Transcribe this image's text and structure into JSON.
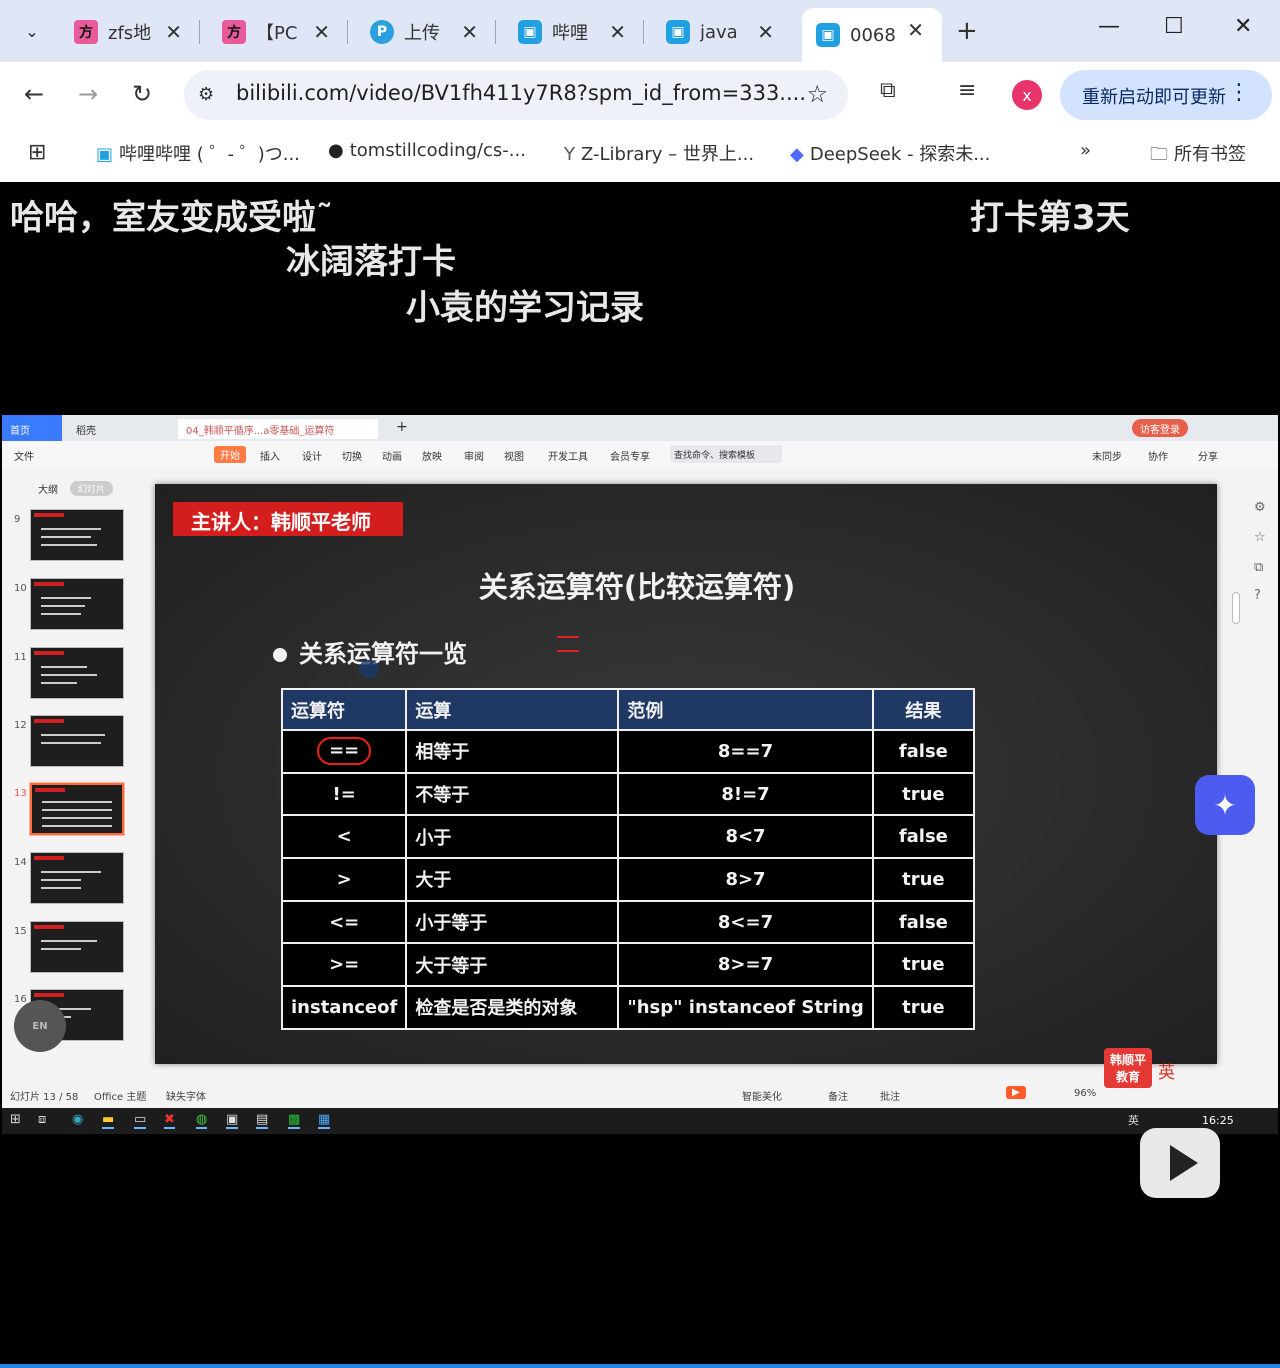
{
  "browser": {
    "tabs": [
      {
        "title": "zfs地",
        "icon": "方"
      },
      {
        "title": "【PC",
        "icon": "方"
      },
      {
        "title": "上传",
        "icon": "P"
      },
      {
        "title": "哔哩",
        "icon": "bili"
      },
      {
        "title": "java",
        "icon": "bili"
      },
      {
        "title": "0068",
        "icon": "bili"
      }
    ],
    "url": "bilibili.com/video/BV1fh411y7R8?spm_id_from=333....",
    "profile_initial": "x",
    "update_label": "重新启动即可更新",
    "bookmarks": [
      "哔哩哔哩 ( ゜- ゜)つ...",
      "tomstillcoding/cs-...",
      "Z-Library – 世界上...",
      "DeepSeek - 探索未...",
      "所有书签"
    ]
  },
  "overlay": {
    "line1": "哈哈，室友变成受啦˜",
    "line2": "冰阔落打卡",
    "line3": "小袁的学习记录",
    "right": "打卡第3天"
  },
  "wps": {
    "tabs": {
      "home": "首页",
      "daoke": "稻壳",
      "doc": "04_韩顺平循序...a零基础_运算符"
    },
    "login": "访客登录",
    "menu": [
      "文件",
      "开始",
      "插入",
      "设计",
      "切换",
      "动画",
      "放映",
      "审阅",
      "视图",
      "开发工具",
      "会员专享"
    ],
    "search_placeholder": "查找命令、搜索模板",
    "menu_right": [
      "未同步",
      "协作",
      "分享"
    ],
    "side": {
      "outline": "大纲",
      "slides": "幻灯片"
    },
    "slide_numbers": [
      "9",
      "10",
      "11",
      "12",
      "13",
      "14",
      "15",
      "16"
    ],
    "en_badge": "EN",
    "status": {
      "slide_pos": "幻灯片 13 / 58",
      "theme": "Office 主题",
      "missing_font": "缺失字体",
      "beautify": "智能美化",
      "notes": "备注",
      "comment": "批注",
      "zoom": "96%"
    },
    "brand_badge": "韩顺平教育",
    "ime": "英"
  },
  "slide": {
    "speaker": "主讲人：韩顺平老师",
    "title": "关系运算符(比较运算符)",
    "bullet": "关系运算符一览",
    "table": {
      "headers": [
        "运算符",
        "运算",
        "范例",
        "结果"
      ],
      "rows": [
        [
          "==",
          "相等于",
          "8==7",
          "false"
        ],
        [
          "!=",
          "不等于",
          "8!=7",
          "true"
        ],
        [
          "<",
          "小于",
          "8<7",
          "false"
        ],
        [
          ">",
          "大于",
          "8>7",
          "true"
        ],
        [
          "<=",
          "小于等于",
          "8<=7",
          "false"
        ],
        [
          ">=",
          "大于等于",
          "8>=7",
          "true"
        ],
        [
          "instanceof",
          "检查是否是类的对象",
          "\"hsp\"  instanceof  String",
          "true"
        ]
      ]
    }
  },
  "taskbar": {
    "clock": "16:25",
    "ime": "英"
  }
}
